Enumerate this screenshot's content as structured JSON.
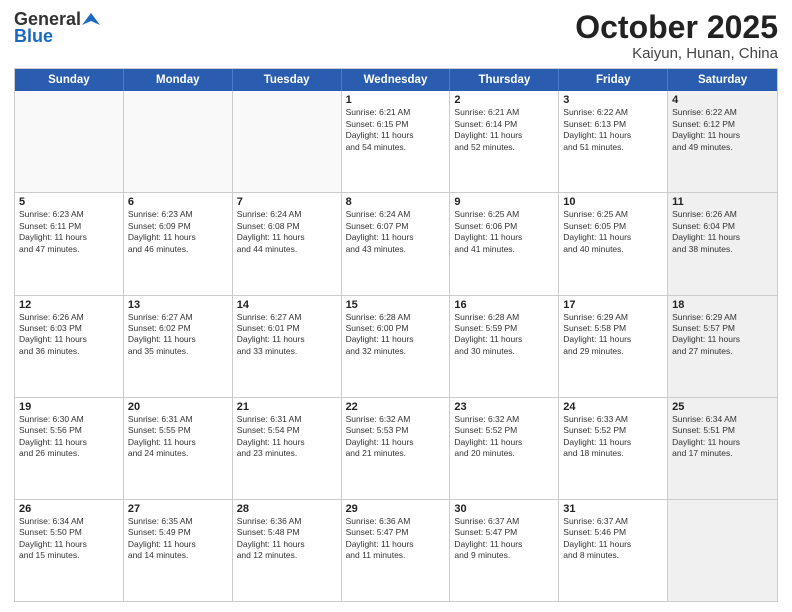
{
  "header": {
    "logo_general": "General",
    "logo_blue": "Blue",
    "title": "October 2025",
    "subtitle": "Kaiyun, Hunan, China"
  },
  "weekdays": [
    "Sunday",
    "Monday",
    "Tuesday",
    "Wednesday",
    "Thursday",
    "Friday",
    "Saturday"
  ],
  "weeks": [
    [
      {
        "day": "",
        "lines": [],
        "empty": true
      },
      {
        "day": "",
        "lines": [],
        "empty": true
      },
      {
        "day": "",
        "lines": [],
        "empty": true
      },
      {
        "day": "1",
        "lines": [
          "Sunrise: 6:21 AM",
          "Sunset: 6:15 PM",
          "Daylight: 11 hours",
          "and 54 minutes."
        ],
        "empty": false
      },
      {
        "day": "2",
        "lines": [
          "Sunrise: 6:21 AM",
          "Sunset: 6:14 PM",
          "Daylight: 11 hours",
          "and 52 minutes."
        ],
        "empty": false
      },
      {
        "day": "3",
        "lines": [
          "Sunrise: 6:22 AM",
          "Sunset: 6:13 PM",
          "Daylight: 11 hours",
          "and 51 minutes."
        ],
        "empty": false
      },
      {
        "day": "4",
        "lines": [
          "Sunrise: 6:22 AM",
          "Sunset: 6:12 PM",
          "Daylight: 11 hours",
          "and 49 minutes."
        ],
        "empty": false,
        "shaded": true
      }
    ],
    [
      {
        "day": "5",
        "lines": [
          "Sunrise: 6:23 AM",
          "Sunset: 6:11 PM",
          "Daylight: 11 hours",
          "and 47 minutes."
        ],
        "empty": false
      },
      {
        "day": "6",
        "lines": [
          "Sunrise: 6:23 AM",
          "Sunset: 6:09 PM",
          "Daylight: 11 hours",
          "and 46 minutes."
        ],
        "empty": false
      },
      {
        "day": "7",
        "lines": [
          "Sunrise: 6:24 AM",
          "Sunset: 6:08 PM",
          "Daylight: 11 hours",
          "and 44 minutes."
        ],
        "empty": false
      },
      {
        "day": "8",
        "lines": [
          "Sunrise: 6:24 AM",
          "Sunset: 6:07 PM",
          "Daylight: 11 hours",
          "and 43 minutes."
        ],
        "empty": false
      },
      {
        "day": "9",
        "lines": [
          "Sunrise: 6:25 AM",
          "Sunset: 6:06 PM",
          "Daylight: 11 hours",
          "and 41 minutes."
        ],
        "empty": false
      },
      {
        "day": "10",
        "lines": [
          "Sunrise: 6:25 AM",
          "Sunset: 6:05 PM",
          "Daylight: 11 hours",
          "and 40 minutes."
        ],
        "empty": false
      },
      {
        "day": "11",
        "lines": [
          "Sunrise: 6:26 AM",
          "Sunset: 6:04 PM",
          "Daylight: 11 hours",
          "and 38 minutes."
        ],
        "empty": false,
        "shaded": true
      }
    ],
    [
      {
        "day": "12",
        "lines": [
          "Sunrise: 6:26 AM",
          "Sunset: 6:03 PM",
          "Daylight: 11 hours",
          "and 36 minutes."
        ],
        "empty": false
      },
      {
        "day": "13",
        "lines": [
          "Sunrise: 6:27 AM",
          "Sunset: 6:02 PM",
          "Daylight: 11 hours",
          "and 35 minutes."
        ],
        "empty": false
      },
      {
        "day": "14",
        "lines": [
          "Sunrise: 6:27 AM",
          "Sunset: 6:01 PM",
          "Daylight: 11 hours",
          "and 33 minutes."
        ],
        "empty": false
      },
      {
        "day": "15",
        "lines": [
          "Sunrise: 6:28 AM",
          "Sunset: 6:00 PM",
          "Daylight: 11 hours",
          "and 32 minutes."
        ],
        "empty": false
      },
      {
        "day": "16",
        "lines": [
          "Sunrise: 6:28 AM",
          "Sunset: 5:59 PM",
          "Daylight: 11 hours",
          "and 30 minutes."
        ],
        "empty": false
      },
      {
        "day": "17",
        "lines": [
          "Sunrise: 6:29 AM",
          "Sunset: 5:58 PM",
          "Daylight: 11 hours",
          "and 29 minutes."
        ],
        "empty": false
      },
      {
        "day": "18",
        "lines": [
          "Sunrise: 6:29 AM",
          "Sunset: 5:57 PM",
          "Daylight: 11 hours",
          "and 27 minutes."
        ],
        "empty": false,
        "shaded": true
      }
    ],
    [
      {
        "day": "19",
        "lines": [
          "Sunrise: 6:30 AM",
          "Sunset: 5:56 PM",
          "Daylight: 11 hours",
          "and 26 minutes."
        ],
        "empty": false
      },
      {
        "day": "20",
        "lines": [
          "Sunrise: 6:31 AM",
          "Sunset: 5:55 PM",
          "Daylight: 11 hours",
          "and 24 minutes."
        ],
        "empty": false
      },
      {
        "day": "21",
        "lines": [
          "Sunrise: 6:31 AM",
          "Sunset: 5:54 PM",
          "Daylight: 11 hours",
          "and 23 minutes."
        ],
        "empty": false
      },
      {
        "day": "22",
        "lines": [
          "Sunrise: 6:32 AM",
          "Sunset: 5:53 PM",
          "Daylight: 11 hours",
          "and 21 minutes."
        ],
        "empty": false
      },
      {
        "day": "23",
        "lines": [
          "Sunrise: 6:32 AM",
          "Sunset: 5:52 PM",
          "Daylight: 11 hours",
          "and 20 minutes."
        ],
        "empty": false
      },
      {
        "day": "24",
        "lines": [
          "Sunrise: 6:33 AM",
          "Sunset: 5:52 PM",
          "Daylight: 11 hours",
          "and 18 minutes."
        ],
        "empty": false
      },
      {
        "day": "25",
        "lines": [
          "Sunrise: 6:34 AM",
          "Sunset: 5:51 PM",
          "Daylight: 11 hours",
          "and 17 minutes."
        ],
        "empty": false,
        "shaded": true
      }
    ],
    [
      {
        "day": "26",
        "lines": [
          "Sunrise: 6:34 AM",
          "Sunset: 5:50 PM",
          "Daylight: 11 hours",
          "and 15 minutes."
        ],
        "empty": false
      },
      {
        "day": "27",
        "lines": [
          "Sunrise: 6:35 AM",
          "Sunset: 5:49 PM",
          "Daylight: 11 hours",
          "and 14 minutes."
        ],
        "empty": false
      },
      {
        "day": "28",
        "lines": [
          "Sunrise: 6:36 AM",
          "Sunset: 5:48 PM",
          "Daylight: 11 hours",
          "and 12 minutes."
        ],
        "empty": false
      },
      {
        "day": "29",
        "lines": [
          "Sunrise: 6:36 AM",
          "Sunset: 5:47 PM",
          "Daylight: 11 hours",
          "and 11 minutes."
        ],
        "empty": false
      },
      {
        "day": "30",
        "lines": [
          "Sunrise: 6:37 AM",
          "Sunset: 5:47 PM",
          "Daylight: 11 hours",
          "and 9 minutes."
        ],
        "empty": false
      },
      {
        "day": "31",
        "lines": [
          "Sunrise: 6:37 AM",
          "Sunset: 5:46 PM",
          "Daylight: 11 hours",
          "and 8 minutes."
        ],
        "empty": false
      },
      {
        "day": "",
        "lines": [],
        "empty": true,
        "shaded": true
      }
    ]
  ]
}
